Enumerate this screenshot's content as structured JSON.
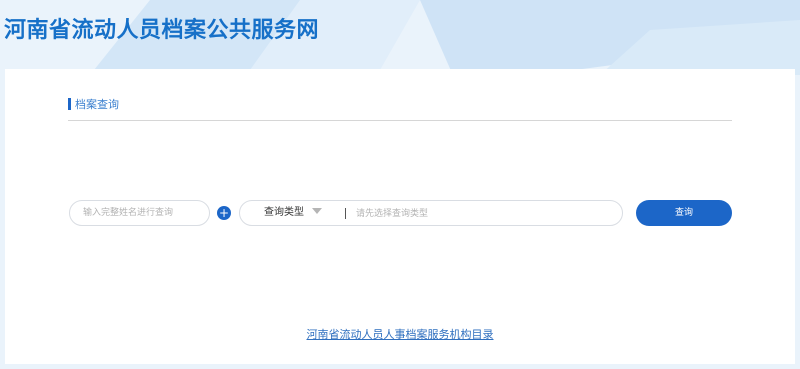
{
  "header": {
    "site_title": "河南省流动人员档案公共服务网"
  },
  "section": {
    "title": "档案查询"
  },
  "search": {
    "name_placeholder": "输入完整姓名进行查询",
    "add_icon_glyph": "+",
    "type_label": "查询类型",
    "type_placeholder": "请先选择查询类型",
    "submit_label": "查询"
  },
  "footer": {
    "directory_link": "河南省流动人员人事档案服务机构目录"
  },
  "colors": {
    "primary": "#1c66c8",
    "title": "#1670c8",
    "background": "#eaf3fb"
  }
}
